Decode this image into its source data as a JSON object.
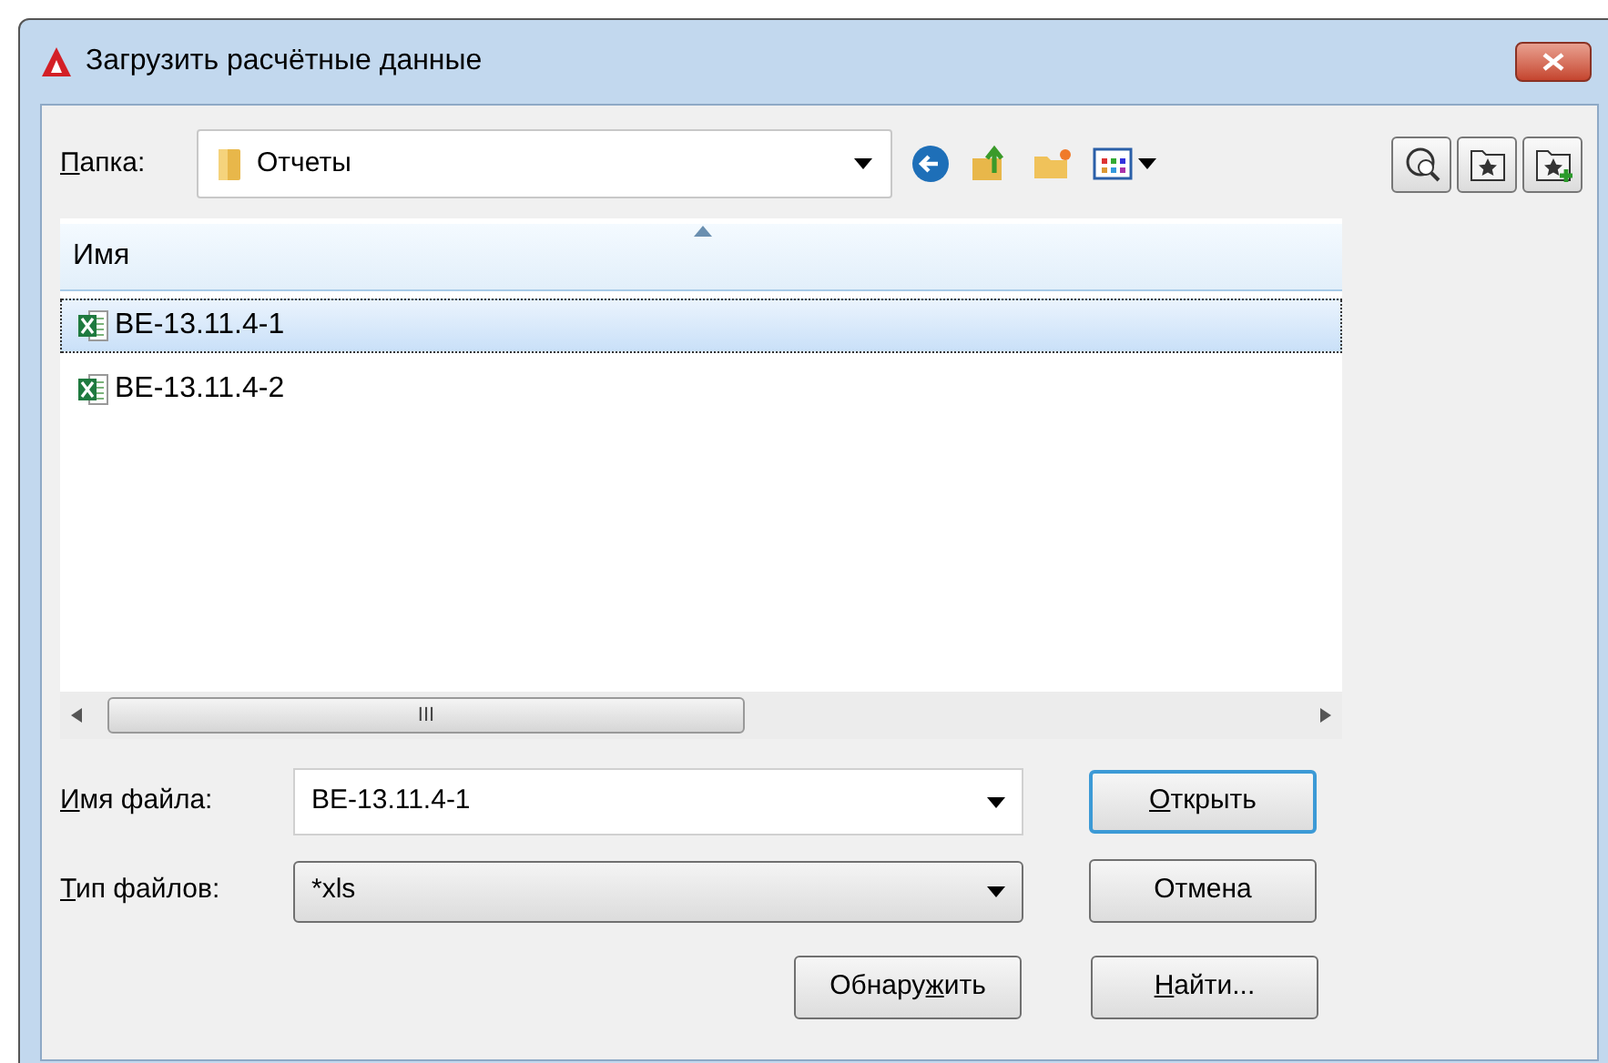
{
  "window": {
    "title": "Загрузить расчётные данные"
  },
  "folder": {
    "label": {
      "key": "П",
      "after": "апка:"
    },
    "value": "Отчеты"
  },
  "file_list": {
    "columns": [
      {
        "label": "Имя",
        "sorted": true
      }
    ],
    "rows": [
      {
        "name": "BE-13.11.4-1",
        "selected": true
      },
      {
        "name": "BE-13.11.4-2",
        "selected": false
      }
    ],
    "scroll_thumb": "III"
  },
  "file_name": {
    "label": {
      "key": "И",
      "after": "мя файла:"
    },
    "value": "BE-13.11.4-1"
  },
  "file_type": {
    "label": {
      "key": "Т",
      "after": "ип файлов:"
    },
    "value": "*xls"
  },
  "buttons": [
    {
      "label": {
        "key": "О",
        "after": "ткрыть"
      },
      "default": true
    },
    {
      "label": {
        "before": "Отмена"
      },
      "default": false
    },
    {
      "label": {
        "before": "Обнару",
        "key": "ж",
        "after": "ить"
      },
      "default": false
    },
    {
      "label": {
        "key": "Н",
        "after": "айти..."
      },
      "default": false
    }
  ]
}
